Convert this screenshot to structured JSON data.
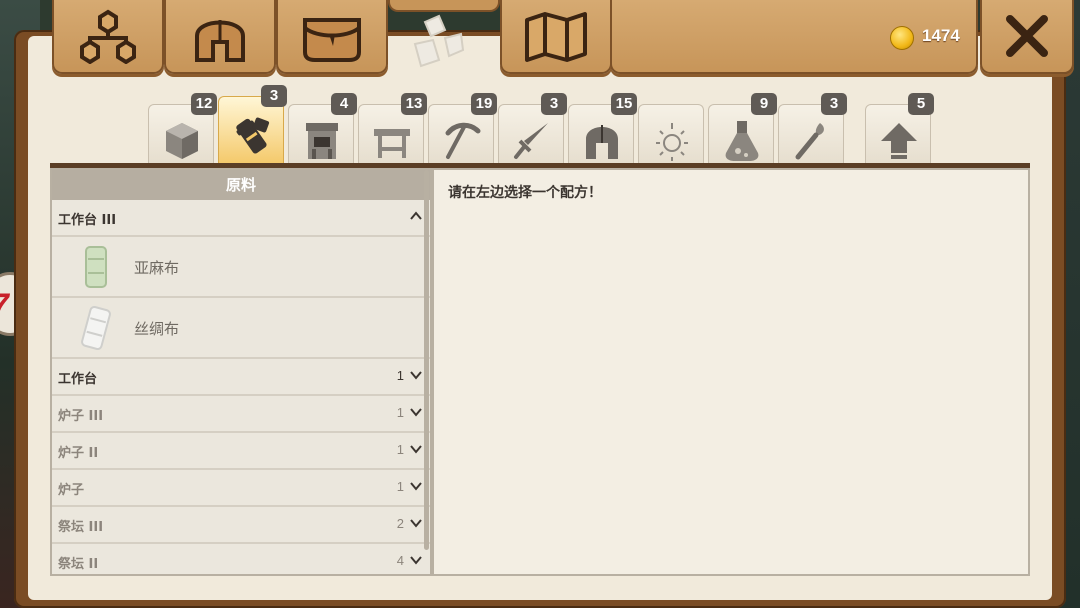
{
  "top_tabs": [
    {
      "name": "skill-tree",
      "icon": "skill-tree-icon"
    },
    {
      "name": "helmet",
      "icon": "helmet-icon"
    },
    {
      "name": "bag",
      "icon": "bag-icon"
    },
    {
      "name": "crafting",
      "icon": "crafting-icon",
      "active": true
    },
    {
      "name": "map",
      "icon": "map-icon"
    }
  ],
  "currency": {
    "icon": "gold-coin-icon",
    "amount": "1474"
  },
  "close": {
    "icon": "close-icon"
  },
  "side_badge": {
    "text": "7"
  },
  "category_tabs": [
    {
      "icon": "cube-icon",
      "count": "12"
    },
    {
      "icon": "material-roll-icon",
      "count": "3",
      "active": true
    },
    {
      "icon": "furnace-icon",
      "count": "4"
    },
    {
      "icon": "workbench-icon",
      "count": "13"
    },
    {
      "icon": "pickaxe-icon",
      "count": "19"
    },
    {
      "icon": "sword-icon",
      "count": "3"
    },
    {
      "icon": "helmet-icon",
      "count": "15"
    },
    {
      "icon": "sparkle-icon",
      "count": ""
    },
    {
      "icon": "potion-icon",
      "count": "9"
    },
    {
      "icon": "torch-icon",
      "count": "3"
    },
    {
      "icon": "upgrade-arrow-icon",
      "count": "5"
    }
  ],
  "left_panel": {
    "header": "原料",
    "groups": [
      {
        "title": "工作台 III",
        "expanded": true,
        "items": [
          {
            "name": "亚麻布",
            "icon": "linen-roll-icon"
          },
          {
            "name": "丝绸布",
            "icon": "silk-roll-icon"
          }
        ]
      },
      {
        "title": "工作台",
        "count": "1",
        "dim": false
      },
      {
        "title": "炉子 III",
        "count": "1",
        "dim": true
      },
      {
        "title": "炉子 II",
        "count": "1",
        "dim": true
      },
      {
        "title": "炉子",
        "count": "1",
        "dim": true
      },
      {
        "title": "祭坛 III",
        "count": "2",
        "dim": true
      },
      {
        "title": "祭坛 II",
        "count": "4",
        "dim": true
      }
    ]
  },
  "right_panel": {
    "prompt": "请在左边选择一个配方！"
  }
}
